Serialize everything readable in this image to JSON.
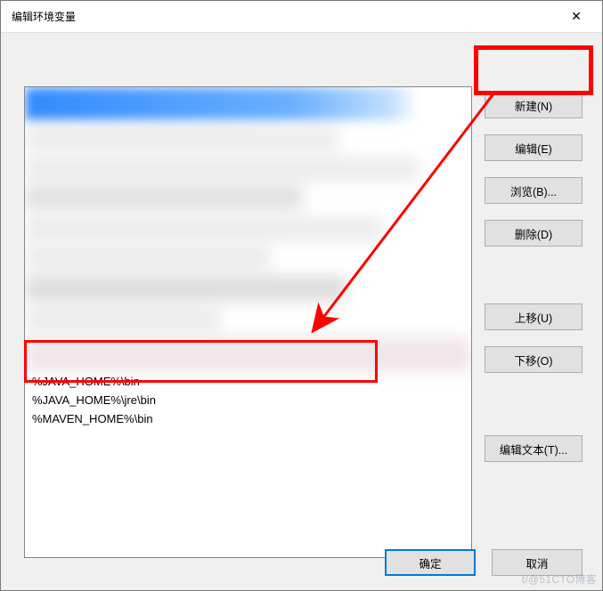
{
  "dialog": {
    "title": "编辑环境变量",
    "close_symbol": "✕"
  },
  "list": {
    "items": [
      "%JAVA_HOME%\\bin",
      "%JAVA_HOME%\\jre\\bin",
      "%MAVEN_HOME%\\bin"
    ]
  },
  "buttons": {
    "new": "新建(N)",
    "edit": "编辑(E)",
    "browse": "浏览(B)...",
    "delete": "删除(D)",
    "move_up": "上移(U)",
    "move_down": "下移(O)",
    "edit_text": "编辑文本(T)...",
    "ok": "确定",
    "cancel": "取消"
  },
  "watermark": "t/@51CTO博客",
  "annotation": {
    "arrow_color": "#f00"
  }
}
